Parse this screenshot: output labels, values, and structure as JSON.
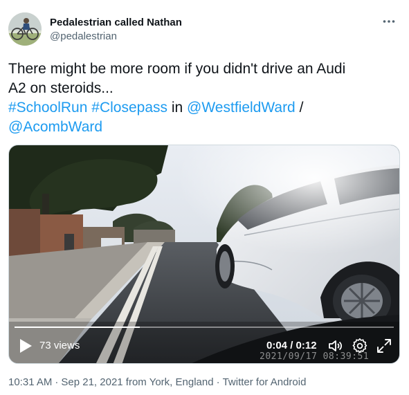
{
  "author": {
    "display_name": "Pedalestrian called Nathan",
    "handle": "@pedalestrian",
    "avatar_icon": "cyclist-photo-avatar"
  },
  "header": {
    "more_icon": "more-horizontal-icon"
  },
  "tweet": {
    "text_line_1": "There might be more room if you didn't drive an Audi",
    "text_line_2": "A2 on steroids...",
    "hashtag_1": "#SchoolRun",
    "hashtag_2": "#Closepass",
    "in_word": "in",
    "mention_1": "@WestfieldWard",
    "slash": "/",
    "mention_2": "@AcombWard"
  },
  "video": {
    "views": "73 views",
    "time": "0:04 / 0:12",
    "progress": 0.33,
    "dashcam_stamp": "2021/09/17  08:39:51",
    "play_icon": "play-icon",
    "volume_icon": "volume-icon",
    "settings_icon": "gear-icon",
    "fullscreen_icon": "fullscreen-icon"
  },
  "meta": {
    "time": "10:31 AM",
    "dot_1": "·",
    "date": "Sep 21, 2021 from York, England",
    "dot_2": "·",
    "source": "Twitter for Android"
  },
  "colors": {
    "link": "#1d9bf0",
    "text": "#0f1419",
    "secondary": "#536471"
  }
}
